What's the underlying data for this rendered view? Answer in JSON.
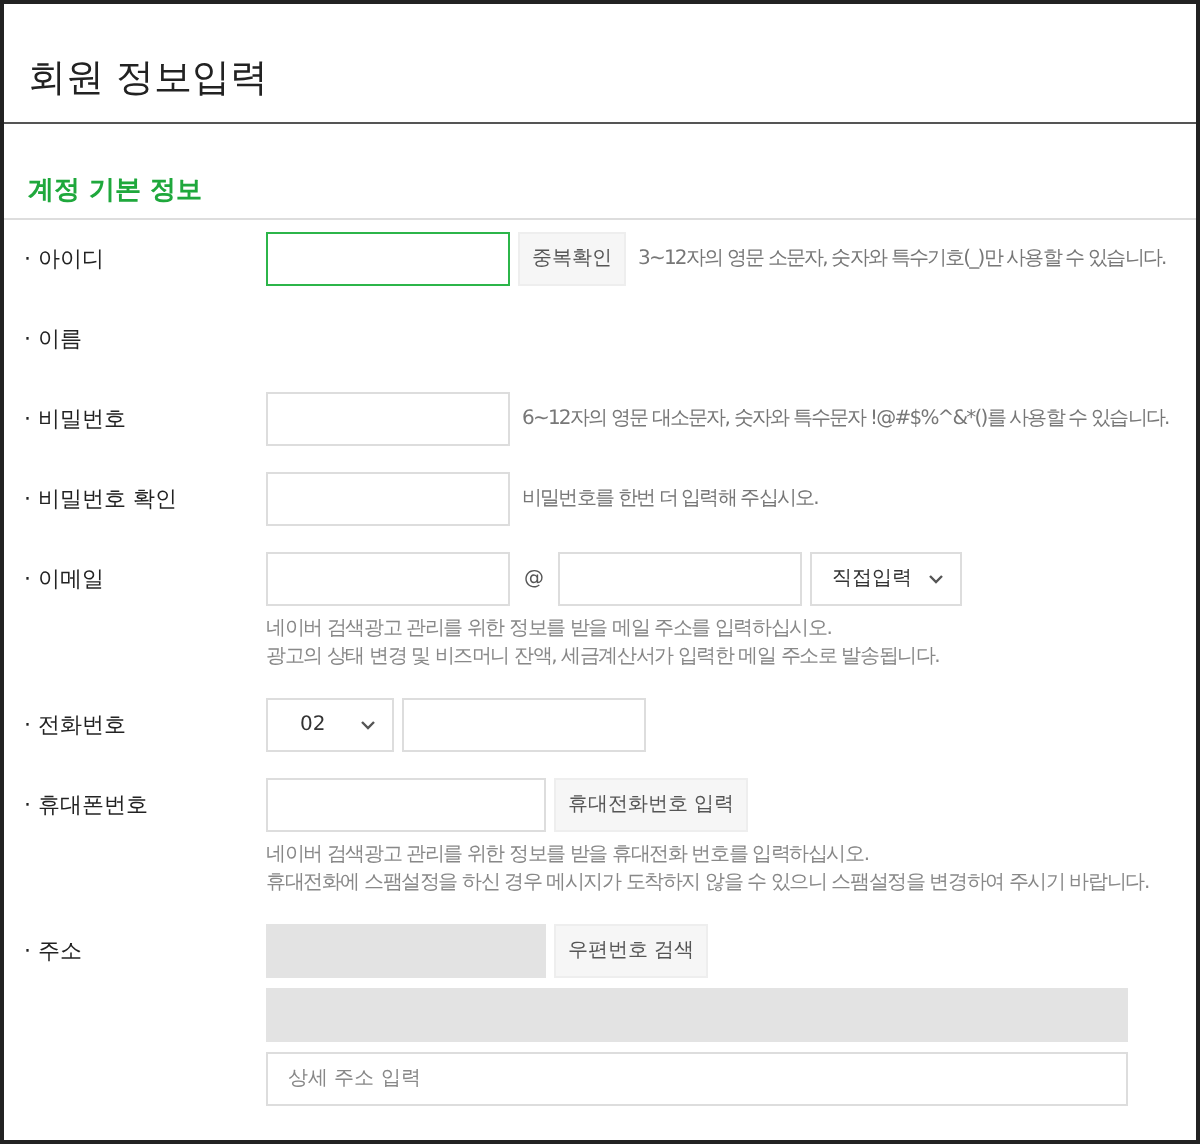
{
  "page_title": "회원 정보입력",
  "section_title": "계정 기본 정보",
  "rows": [
    {
      "label": "· 아이디",
      "lines": [
        [
          {
            "kind": "input",
            "focused": true
          },
          {
            "kind": "button",
            "text": "중복확인"
          },
          {
            "kind": "hint",
            "text": "3~12자의 영문 소문자, 숫자와 특수기호(_)만 사용할 수 있습니다."
          }
        ]
      ]
    },
    {
      "label": "· 이름",
      "lines": []
    },
    {
      "label": "· 비밀번호",
      "lines": [
        [
          {
            "kind": "input",
            "focused": false
          },
          {
            "kind": "hint",
            "text": "6~12자의 영문 대소문자, 숫자와 특수문자 !@#$%^&*()를 사용할 수 있습니다."
          }
        ]
      ]
    },
    {
      "label": "· 비밀번호 확인",
      "lines": [
        [
          {
            "kind": "input",
            "focused": false
          },
          {
            "kind": "hint",
            "text": "비밀번호를 한번 더 입력해 주십시오."
          }
        ]
      ]
    },
    {
      "label": "· 이메일",
      "lines": [
        [
          {
            "kind": "input",
            "focused": false
          },
          {
            "kind": "at",
            "text": "@"
          },
          {
            "kind": "input",
            "focused": false
          },
          {
            "kind": "select",
            "text": "직접입력"
          }
        ]
      ],
      "notes": [
        "네이버 검색광고 관리를 위한 정보를 받을 메일 주소를 입력하십시오.",
        "광고의 상태 변경 및 비즈머니 잔액, 세금계산서가 입력한 메일 주소로 발송됩니다."
      ]
    },
    {
      "label": "· 전화번호",
      "lines": [
        [
          {
            "kind": "select",
            "text": "02"
          },
          {
            "kind": "input",
            "focused": false
          }
        ]
      ]
    },
    {
      "label": "· 휴대폰번호",
      "lines": [
        [
          {
            "kind": "medium-input",
            "focused": false
          },
          {
            "kind": "button",
            "text": "휴대전화번호 입력"
          }
        ]
      ],
      "notes": [
        "네이버 검색광고 관리를 위한 정보를 받을 휴대전화 번호를 입력하십시오.",
        "휴대전화에 스팸설정을 하신 경우 메시지가 도착하지 않을 수 있으니 스팸설정을 변경하여 주시기 바랍니다."
      ]
    },
    {
      "label": "· 주소",
      "lines": [
        [
          {
            "kind": "medium-input",
            "disabled": true
          },
          {
            "kind": "button",
            "text": "우편번호 검색"
          }
        ],
        [
          {
            "kind": "full-input",
            "disabled": true
          }
        ],
        [
          {
            "kind": "full-input",
            "focused": false,
            "placeholder": "상세 주소 입력"
          }
        ]
      ]
    }
  ]
}
